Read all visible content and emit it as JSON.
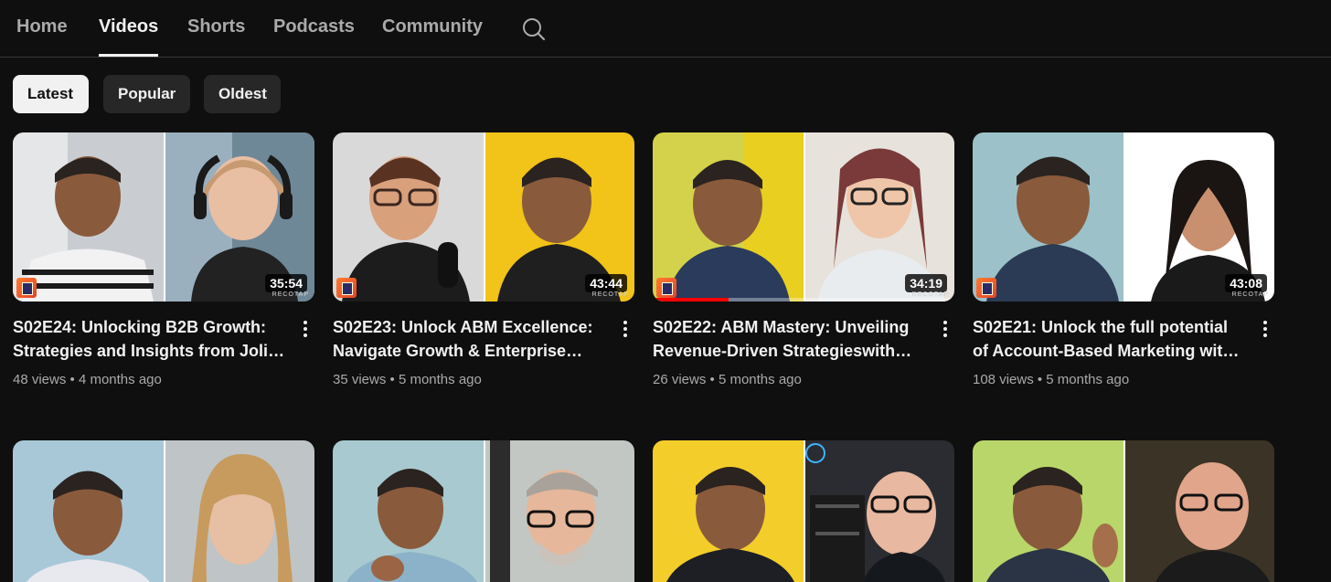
{
  "tabs": [
    {
      "label": "Home"
    },
    {
      "label": "Videos"
    },
    {
      "label": "Shorts"
    },
    {
      "label": "Podcasts"
    },
    {
      "label": "Community"
    }
  ],
  "chips": [
    {
      "label": "Latest"
    },
    {
      "label": "Popular"
    },
    {
      "label": "Oldest"
    }
  ],
  "watermark": "RECOTAP",
  "videos": [
    {
      "title": "S02E24: Unlocking B2B Growth: Strategies and Insights from Jolie Spiers",
      "duration": "35:54",
      "views": "48 views",
      "age": "4 months ago"
    },
    {
      "title": "S02E23: Unlock ABM Excellence: Navigate Growth & Enterprise Success",
      "duration": "43:44",
      "views": "35 views",
      "age": "5 months ago"
    },
    {
      "title": "S02E22: ABM Mastery: Unveiling Revenue-Driven Strategieswith Experts",
      "duration": "34:19",
      "views": "26 views",
      "age": "5 months ago",
      "progress": 0.25
    },
    {
      "title": "S02E21: Unlock the full potential of Account-Based Marketing with Experts",
      "duration": "43:08",
      "views": "108 views",
      "age": "5 months ago"
    }
  ],
  "colors": {
    "background": "#0f0f0f",
    "accent": "#ff0000",
    "muted": "#aaaaaa"
  }
}
